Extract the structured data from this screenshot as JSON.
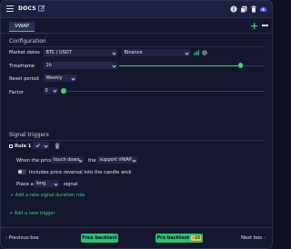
{
  "header": {
    "title": "DOCS"
  },
  "tabs": {
    "active_label": "VWAP",
    "add_label": "+"
  },
  "configuration": {
    "title": "Configuration",
    "market_dates": {
      "label": "Market dates",
      "pair": "BTC / USDT",
      "exchange": "Binance"
    },
    "timeframe": {
      "label": "Timeframe",
      "value": "1h"
    },
    "reset_period": {
      "label": "Reset period",
      "value": "Weekly"
    },
    "factor": {
      "label": "Factor",
      "value": "0"
    }
  },
  "signal_triggers": {
    "title": "Signal triggers",
    "rule": {
      "label": "Rule 1",
      "when_the_price": "When the price",
      "condition": "touch down",
      "the": "the",
      "target": "support VWAP",
      "include_wick_label": "Includes price reversal into the candle wick",
      "place_a": "Place a",
      "direction": "long",
      "signal": "signal",
      "add_duration_rule": "+ Add a new signal duration rule"
    },
    "add_trigger": "+ Add a new trigger"
  },
  "footer": {
    "previous": "Previous box",
    "free_backtest": "Free backtest",
    "pro_backtest": "Pro backtest",
    "pro_badge": "25",
    "next": "Next box"
  },
  "colors": {
    "accent": "#3ccf7a",
    "background": "#15172f",
    "badge": "#f2c94c"
  },
  "controls": {
    "timeframe_slider_fraction": 0.83,
    "factor_slider_fraction": 0.02
  }
}
